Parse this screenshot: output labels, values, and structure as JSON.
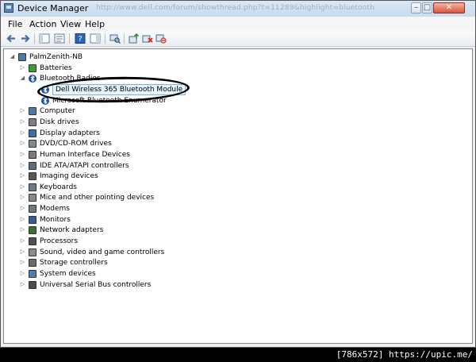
{
  "window": {
    "title": "Device Manager",
    "ghost_url": "http://www.dell.com/forum/showthread.php?t=11289&highlight=bluetooth"
  },
  "controls": {
    "minimize": "–",
    "maximize": "□",
    "close": "✕"
  },
  "menu": [
    "File",
    "Action",
    "View",
    "Help"
  ],
  "toolbar_icons": [
    "back-arrow-icon",
    "forward-arrow-icon",
    "show-hide-console-tree-icon",
    "properties-icon",
    "help-icon",
    "action-pane-icon",
    "scan-hardware-icon",
    "update-driver-icon",
    "uninstall-icon",
    "disable-device-icon"
  ],
  "tree": {
    "root": "PalmZenith-NB",
    "categories": [
      {
        "label": "Batteries",
        "icon": "battery-icon",
        "expanded": false
      },
      {
        "label": "Bluetooth Radios",
        "icon": "bluetooth-icon",
        "expanded": true,
        "children": [
          "Dell Wireless 365 Bluetooth Module",
          "Microsoft Bluetooth Enumerator"
        ]
      },
      {
        "label": "Computer",
        "icon": "computer-icon",
        "expanded": false
      },
      {
        "label": "Disk drives",
        "icon": "disk-drive-icon",
        "expanded": false
      },
      {
        "label": "Display adapters",
        "icon": "display-adapter-icon",
        "expanded": false
      },
      {
        "label": "DVD/CD-ROM drives",
        "icon": "dvd-drive-icon",
        "expanded": false
      },
      {
        "label": "Human Interface Devices",
        "icon": "hid-icon",
        "expanded": false
      },
      {
        "label": "IDE ATA/ATAPI controllers",
        "icon": "ide-controller-icon",
        "expanded": false
      },
      {
        "label": "Imaging devices",
        "icon": "camera-icon",
        "expanded": false
      },
      {
        "label": "Keyboards",
        "icon": "keyboard-icon",
        "expanded": false
      },
      {
        "label": "Mice and other pointing devices",
        "icon": "mouse-icon",
        "expanded": false
      },
      {
        "label": "Modems",
        "icon": "modem-icon",
        "expanded": false
      },
      {
        "label": "Monitors",
        "icon": "monitor-icon",
        "expanded": false
      },
      {
        "label": "Network adapters",
        "icon": "network-adapter-icon",
        "expanded": false
      },
      {
        "label": "Processors",
        "icon": "processor-icon",
        "expanded": false
      },
      {
        "label": "Sound, video and game controllers",
        "icon": "sound-icon",
        "expanded": false
      },
      {
        "label": "Storage controllers",
        "icon": "storage-controller-icon",
        "expanded": false
      },
      {
        "label": "System devices",
        "icon": "system-device-icon",
        "expanded": false
      },
      {
        "label": "Universal Serial Bus controllers",
        "icon": "usb-icon",
        "expanded": false
      }
    ]
  },
  "watermark": "[786x572] https://upic.me/"
}
